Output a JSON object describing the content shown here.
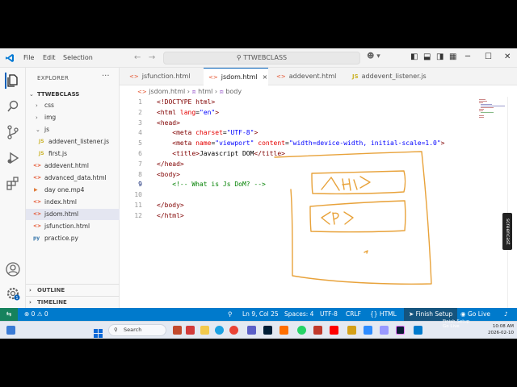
{
  "titlebar": {
    "menu": [
      "File",
      "Edit",
      "Selection"
    ],
    "search": "TTWEBCLASS"
  },
  "explorer": {
    "title": "EXPLORER",
    "more": "···",
    "root": "TTWEBCLASS",
    "items": [
      {
        "label": "css",
        "icon": "folder-icon",
        "kind": "folder"
      },
      {
        "label": "img",
        "icon": "folder-icon",
        "kind": "folder"
      },
      {
        "label": "js",
        "icon": "folder-open-icon",
        "kind": "folder"
      },
      {
        "label": "addevent_listener.js",
        "icon": "JS",
        "kind": "js"
      },
      {
        "label": "first.js",
        "icon": "JS",
        "kind": "js"
      },
      {
        "label": "addevent.html",
        "icon": "<>",
        "kind": "html"
      },
      {
        "label": "advanced_data.html",
        "icon": "<>",
        "kind": "html"
      },
      {
        "label": "day one.mp4",
        "icon": "▶",
        "kind": "video"
      },
      {
        "label": "index.html",
        "icon": "<>",
        "kind": "html"
      },
      {
        "label": "jsdom.html",
        "icon": "<>",
        "kind": "html",
        "selected": true
      },
      {
        "label": "jsfunction.html",
        "icon": "<>",
        "kind": "html"
      },
      {
        "label": "practice.py",
        "icon": "py",
        "kind": "py"
      }
    ],
    "outline": "OUTLINE",
    "timeline": "TIMELINE"
  },
  "tabs": [
    {
      "label": "jsfunction.html",
      "icon": "<>"
    },
    {
      "label": "jsdom.html",
      "icon": "<>",
      "active": true,
      "close": "×"
    },
    {
      "label": "addevent.html",
      "icon": "<>"
    },
    {
      "label": "addevent_listener.js",
      "icon": "JS"
    }
  ],
  "breadcrumb": [
    "jsdom.html",
    "html",
    "body"
  ],
  "editor": {
    "current_line": 9,
    "lines": [
      {
        "n": "1",
        "tokens": [
          [
            "doc",
            "<!DOCTYPE html>"
          ]
        ]
      },
      {
        "n": "2",
        "tokens": [
          [
            "tag",
            "<html "
          ],
          [
            "attr",
            "lang"
          ],
          [
            "txt",
            "="
          ],
          [
            "val",
            "\"en\""
          ],
          [
            "tag",
            ">"
          ]
        ]
      },
      {
        "n": "3",
        "tokens": [
          [
            "tag",
            "<head>"
          ]
        ]
      },
      {
        "n": "4",
        "tokens": [
          [
            "txt",
            "    "
          ],
          [
            "tag",
            "<meta "
          ],
          [
            "attr",
            "charset"
          ],
          [
            "txt",
            "="
          ],
          [
            "val",
            "\"UTF-8\""
          ],
          [
            "tag",
            ">"
          ]
        ]
      },
      {
        "n": "5",
        "tokens": [
          [
            "txt",
            "    "
          ],
          [
            "tag",
            "<meta "
          ],
          [
            "attr",
            "name"
          ],
          [
            "txt",
            "="
          ],
          [
            "val",
            "\"viewport\""
          ],
          [
            "txt",
            " "
          ],
          [
            "attr",
            "content"
          ],
          [
            "txt",
            "="
          ],
          [
            "val",
            "\"width=device-width, initial-scale=1.0\""
          ],
          [
            "tag",
            ">"
          ]
        ]
      },
      {
        "n": "6",
        "tokens": [
          [
            "txt",
            "    "
          ],
          [
            "tag",
            "<title>"
          ],
          [
            "txt",
            "Javascript DOM"
          ],
          [
            "tag",
            "</title>"
          ]
        ]
      },
      {
        "n": "7",
        "tokens": [
          [
            "tag",
            "</head>"
          ]
        ]
      },
      {
        "n": "8",
        "tokens": [
          [
            "tag",
            "<body>"
          ]
        ]
      },
      {
        "n": "9",
        "tokens": [
          [
            "txt",
            "    "
          ],
          [
            "com",
            "<!-- What is Js DoM? -->"
          ]
        ]
      },
      {
        "n": "10",
        "tokens": []
      },
      {
        "n": "11",
        "tokens": [
          [
            "tag",
            "</body>"
          ]
        ]
      },
      {
        "n": "12",
        "tokens": [
          [
            "tag",
            "</html>"
          ]
        ]
      }
    ]
  },
  "screencast_tab": "screencast",
  "statusbar": {
    "remote": "⇆",
    "problems": "⊗ 0 ⚠ 0",
    "zoom": "🔍",
    "position": "Ln 9, Col 25",
    "spaces": "Spaces: 4",
    "encoding": "UTF-8",
    "eol": "CRLF",
    "language": "{} HTML",
    "finish_setup": "Finish Setup",
    "go_live": "Go Live",
    "bell": "🔔"
  },
  "taskbar": {
    "search": "Search",
    "toast_top": "Finish Setup",
    "toast_bottom": "Go Live",
    "clock_time": "10:08 AM",
    "clock_date": "2026-02-10"
  },
  "colors": {
    "statusbar": "#007acc",
    "accent": "#005fb8",
    "pen": "#e8a23a"
  }
}
